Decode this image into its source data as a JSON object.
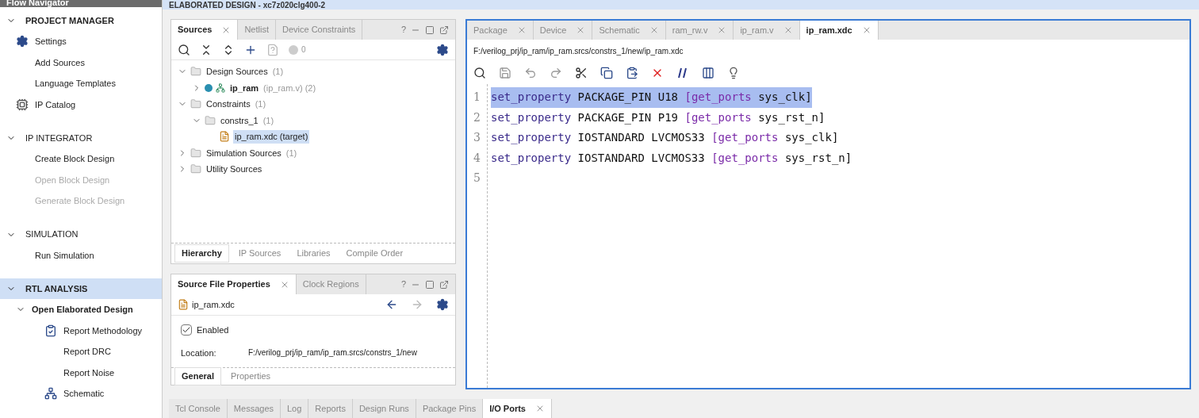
{
  "flow_navigator": {
    "title": "Flow Navigator",
    "sections": [
      {
        "title": "PROJECT MANAGER",
        "emphasized": true,
        "selected": false,
        "items": [
          {
            "label": "Settings",
            "kind": "gear",
            "disabled": false
          },
          {
            "label": "Add Sources",
            "disabled": false
          },
          {
            "label": "Language Templates",
            "disabled": false
          },
          {
            "label": "IP Catalog",
            "kind": "chip",
            "disabled": false
          }
        ]
      },
      {
        "title": "IP INTEGRATOR",
        "emphasized": false,
        "selected": false,
        "items": [
          {
            "label": "Create Block Design",
            "disabled": false
          },
          {
            "label": "Open Block Design",
            "disabled": true
          },
          {
            "label": "Generate Block Design",
            "disabled": true
          }
        ]
      },
      {
        "title": "SIMULATION",
        "emphasized": false,
        "selected": false,
        "items": [
          {
            "label": "Run Simulation",
            "disabled": false
          }
        ]
      },
      {
        "title": "RTL ANALYSIS",
        "emphasized": true,
        "selected": true,
        "items": [
          {
            "label": "Open Elaborated Design",
            "disabled": false,
            "bold": true,
            "expanded": true,
            "children": [
              {
                "label": "Report Methodology",
                "kind": "clipboard",
                "disabled": false
              },
              {
                "label": "Report DRC",
                "disabled": false
              },
              {
                "label": "Report Noise",
                "disabled": false
              },
              {
                "label": "Schematic",
                "kind": "schematic",
                "disabled": false
              }
            ]
          }
        ]
      }
    ]
  },
  "design_title": "ELABORATED DESIGN - xc7z020clg400-2",
  "sources": {
    "tabs": [
      {
        "label": "Sources",
        "selected": true
      },
      {
        "label": "Netlist",
        "selected": false
      },
      {
        "label": "Device Constraints",
        "selected": false
      }
    ],
    "help_label": "?",
    "toolbar_count": "0",
    "tree": [
      {
        "label": "Design Sources",
        "suffix": "(1)",
        "kind": "folder",
        "expanded": true,
        "selected": false,
        "children": [
          {
            "label": "ip_ram",
            "detail": "(ip_ram.v) (2)",
            "kind": "module",
            "bold": true,
            "expanded": false,
            "selected": false
          }
        ]
      },
      {
        "label": "Constraints",
        "suffix": "(1)",
        "kind": "folder",
        "expanded": true,
        "selected": false,
        "children": [
          {
            "label": "constrs_1",
            "suffix": "(1)",
            "kind": "folder",
            "expanded": true,
            "selected": false,
            "children": [
              {
                "label": "ip_ram.xdc (target)",
                "kind": "file",
                "selected": true
              }
            ]
          }
        ]
      },
      {
        "label": "Simulation Sources",
        "suffix": "(1)",
        "kind": "folder",
        "expanded": false,
        "selected": false
      },
      {
        "label": "Utility Sources",
        "kind": "folder",
        "expanded": false,
        "selected": false
      }
    ],
    "bottom_tabs": [
      {
        "label": "Hierarchy",
        "selected": true
      },
      {
        "label": "IP Sources",
        "selected": false
      },
      {
        "label": "Libraries",
        "selected": false
      },
      {
        "label": "Compile Order",
        "selected": false
      }
    ]
  },
  "properties": {
    "tabs": [
      {
        "label": "Source File Properties",
        "selected": true
      },
      {
        "label": "Clock Regions",
        "selected": false
      }
    ],
    "help_label": "?",
    "file": "ip_ram.xdc",
    "enabled": {
      "label": "Enabled",
      "checked": true
    },
    "location_label": "Location:",
    "location_value": "F:/verilog_prj/ip_ram/ip_ram.srcs/constrs_1/new",
    "bottom_tabs": [
      {
        "label": "General",
        "selected": true
      },
      {
        "label": "Properties",
        "selected": false
      }
    ]
  },
  "editor": {
    "tabs": [
      {
        "label": "Package",
        "selected": false
      },
      {
        "label": "Device",
        "selected": false
      },
      {
        "label": "Schematic",
        "selected": false
      },
      {
        "label": "ram_rw.v",
        "selected": false
      },
      {
        "label": "ip_ram.v",
        "selected": false
      },
      {
        "label": "ip_ram.xdc",
        "selected": true
      }
    ],
    "path": "F:/verilog_prj/ip_ram/ip_ram.srcs/constrs_1/new/ip_ram.xdc",
    "lines": [
      {
        "number": "1",
        "selected": true,
        "tokens": [
          {
            "kind": "command",
            "text": "set_property"
          },
          {
            "kind": "plain",
            "text": " PACKAGE_PIN U18 "
          },
          {
            "kind": "bracket",
            "text": "[get_ports"
          },
          {
            "kind": "plain",
            "text": " sys_clk]"
          }
        ]
      },
      {
        "number": "2",
        "selected": false,
        "tokens": [
          {
            "kind": "command",
            "text": "set_property"
          },
          {
            "kind": "plain",
            "text": " PACKAGE_PIN P19 "
          },
          {
            "kind": "bracket",
            "text": "[get_ports"
          },
          {
            "kind": "plain",
            "text": " sys_rst_n]"
          }
        ]
      },
      {
        "number": "3",
        "selected": false,
        "tokens": [
          {
            "kind": "command",
            "text": "set_property"
          },
          {
            "kind": "plain",
            "text": " IOSTANDARD LVCMOS33 "
          },
          {
            "kind": "bracket",
            "text": "[get_ports"
          },
          {
            "kind": "plain",
            "text": " sys_clk]"
          }
        ]
      },
      {
        "number": "4",
        "selected": false,
        "tokens": [
          {
            "kind": "command",
            "text": "set_property"
          },
          {
            "kind": "plain",
            "text": " IOSTANDARD LVCMOS33 "
          },
          {
            "kind": "bracket",
            "text": "[get_ports"
          },
          {
            "kind": "plain",
            "text": " sys_rst_n]"
          }
        ]
      },
      {
        "number": "5"
      }
    ]
  },
  "console_tabs": [
    {
      "label": "Tcl Console",
      "selected": false
    },
    {
      "label": "Messages",
      "selected": false
    },
    {
      "label": "Log",
      "selected": false
    },
    {
      "label": "Reports",
      "selected": false
    },
    {
      "label": "Design Runs",
      "selected": false
    },
    {
      "label": "Package Pins",
      "selected": false
    },
    {
      "label": "I/O Ports",
      "selected": true
    }
  ]
}
